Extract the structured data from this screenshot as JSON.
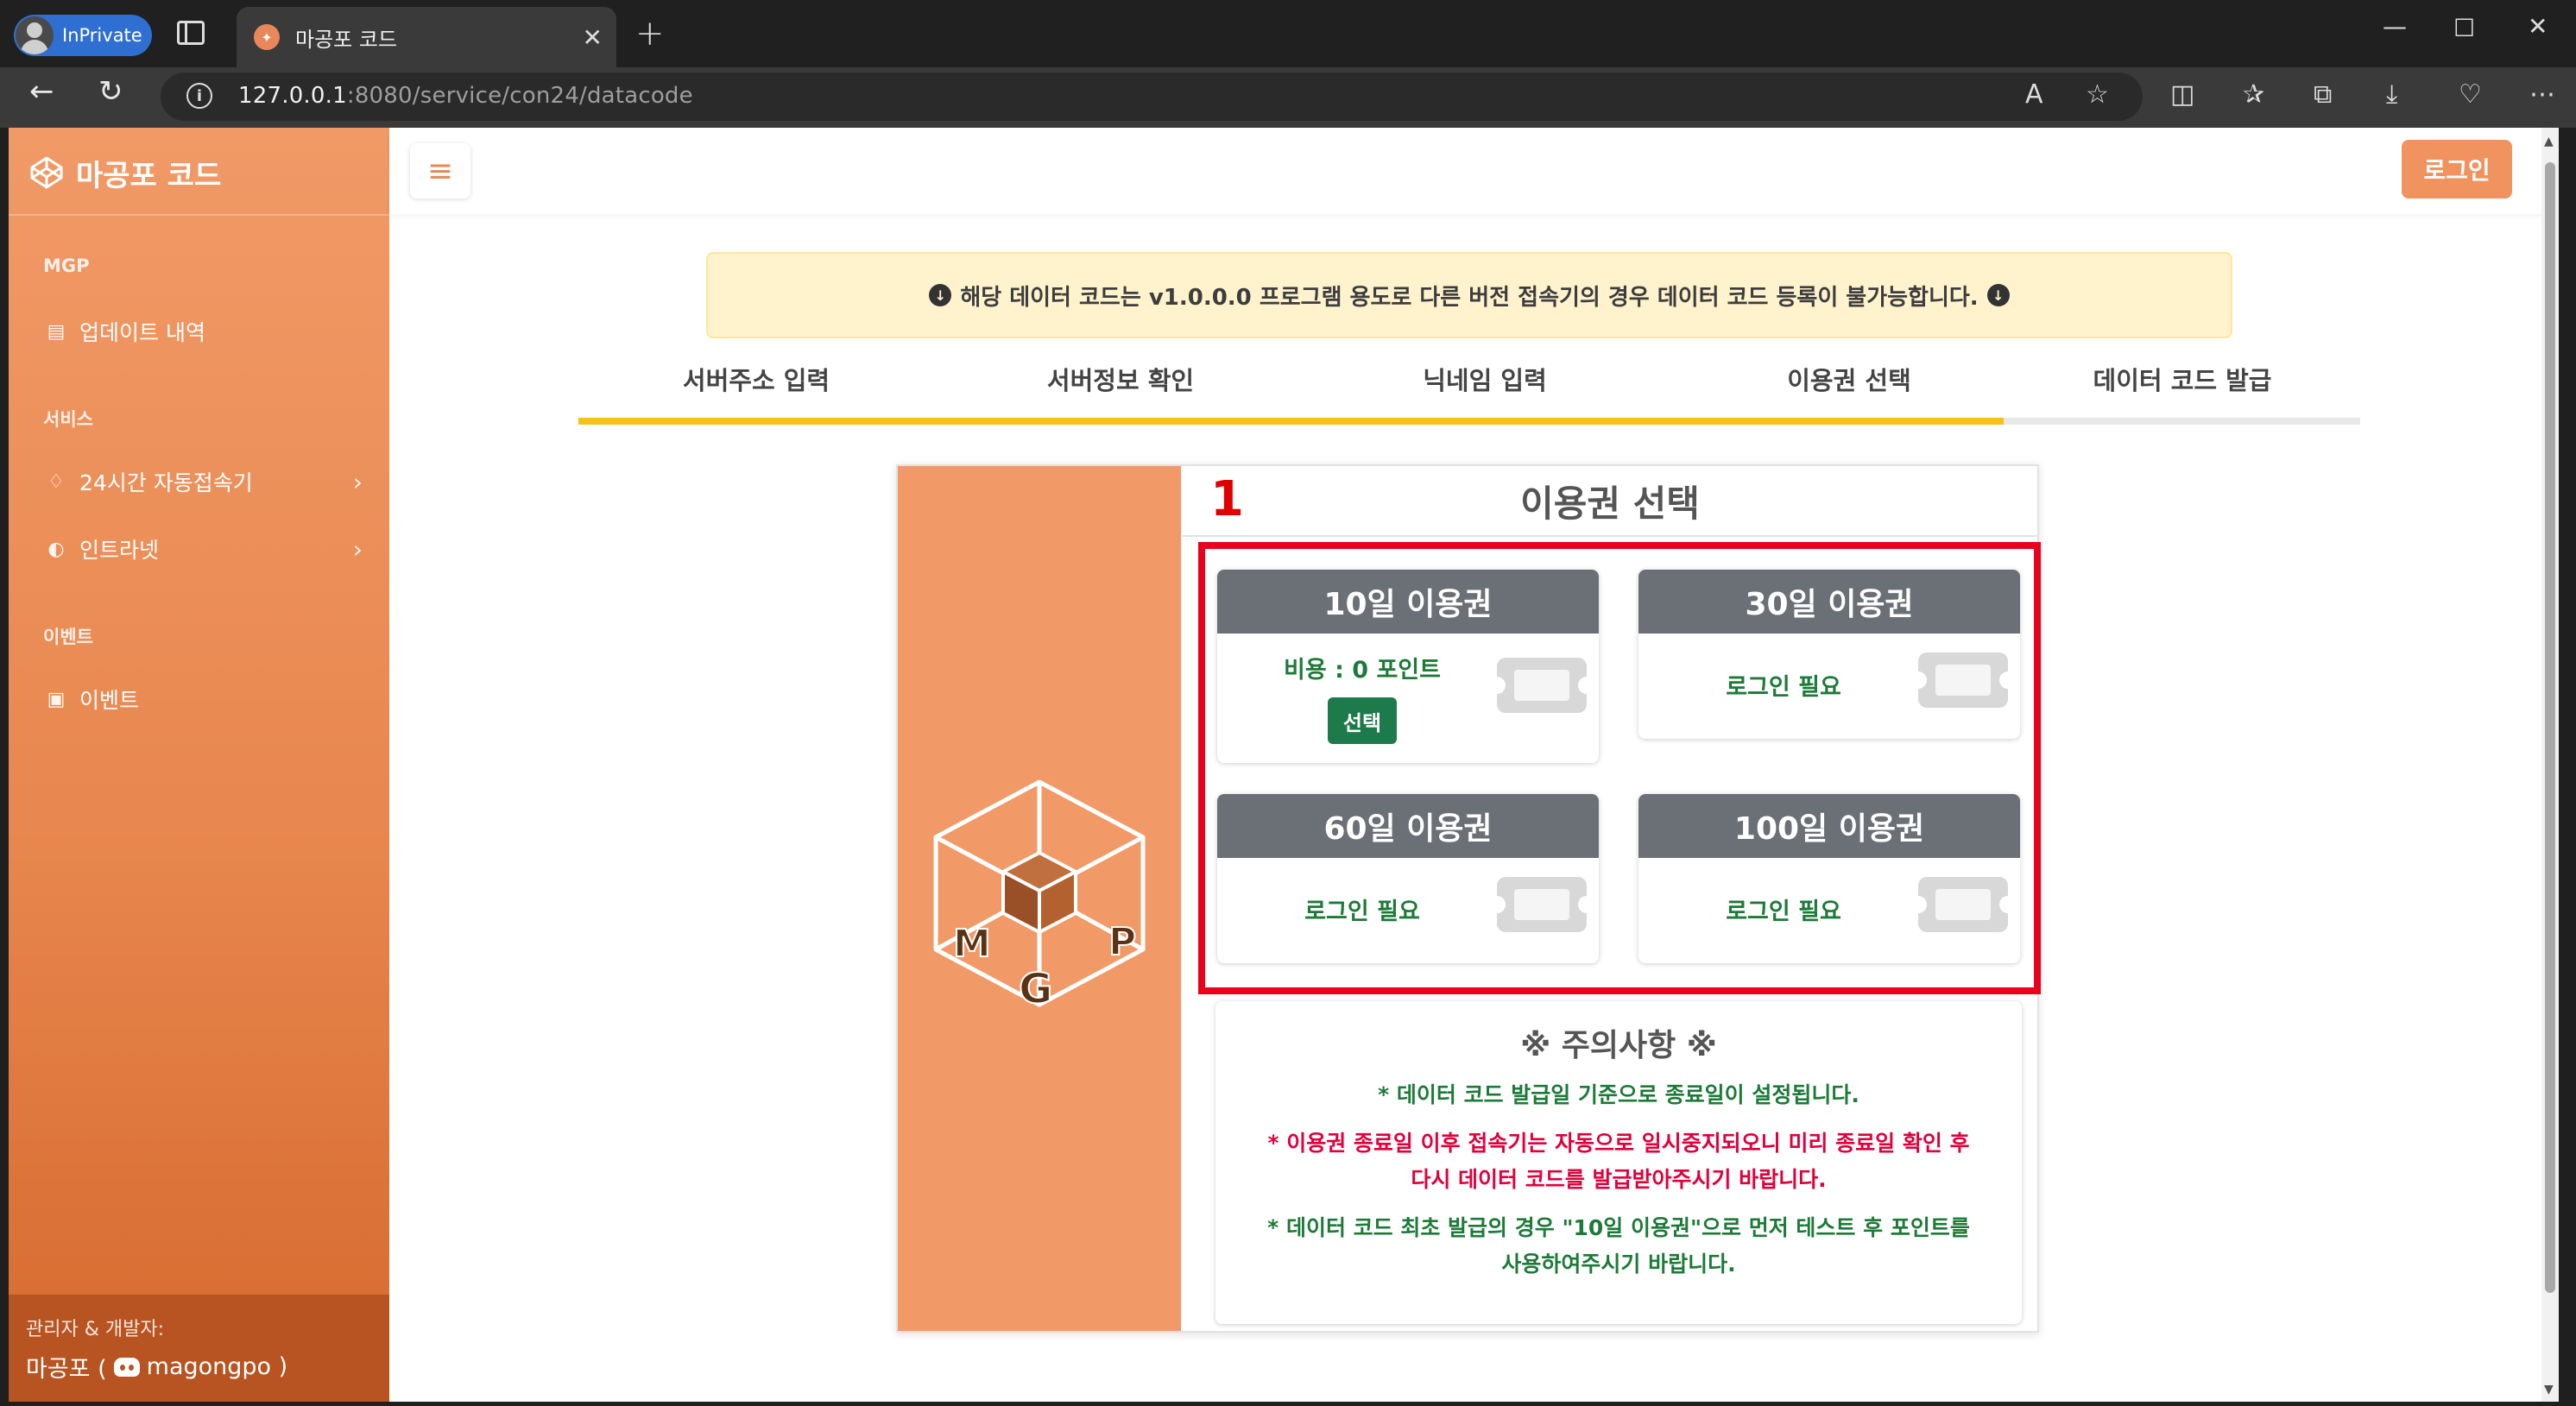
{
  "browser": {
    "inprivate_label": "InPrivate",
    "tab_title": "마공포 코드",
    "url_host": "127.0.0.1",
    "url_rest": ":8080/service/con24/datacode"
  },
  "sidebar": {
    "brand": "마공포 코드",
    "sections": [
      {
        "label": "MGP",
        "items": [
          {
            "label": "업데이트 내역",
            "icon": "clipboard-icon"
          }
        ]
      },
      {
        "label": "서비스",
        "items": [
          {
            "label": "24시간 자동접속기",
            "icon": "lightbulb-icon"
          },
          {
            "label": "인트라넷",
            "icon": "half-circle-icon"
          }
        ]
      },
      {
        "label": "이벤트",
        "items": [
          {
            "label": "이벤트",
            "icon": "calendar-icon"
          }
        ]
      }
    ],
    "footer_label": "관리자 & 개발자:",
    "footer_name": "마공포 (",
    "footer_discord": "magongpo )"
  },
  "topbar": {
    "menu_icon": "hamburger-icon",
    "login_label": "로그인"
  },
  "notice": {
    "text": "해당 데이터 코드는 v1.0.0.0 프로그램 용도로 다른 버전 접속기의 경우 데이터 코드 등록이 불가능합니다."
  },
  "steps": {
    "labels": [
      "서버주소 입력",
      "서버정보 확인",
      "닉네임 입력",
      "이용권 선택",
      "데이터 코드 발급"
    ],
    "completed_fraction": 0.8
  },
  "card": {
    "title": "이용권 선택",
    "annotation_number": "1",
    "tickets": [
      {
        "title": "10일 이용권",
        "cost": "비용 : 0 포인트",
        "button": "선택"
      },
      {
        "title": "30일 이용권",
        "status": "로그인 필요"
      },
      {
        "title": "60일 이용권",
        "status": "로그인 필요"
      },
      {
        "title": "100일 이용권",
        "status": "로그인 필요"
      }
    ],
    "caution": {
      "title": "※ 주의사항 ※",
      "line1": "* 데이터 코드 발급일 기준으로 종료일이 설정됩니다.",
      "line2a": "* 이용권 종료일 이후 접속기는 자동으로 일시중지되오니 미리 종료일 확인 후",
      "line2b": "다시 데이터 코드를 발급받아주시기 바랍니다.",
      "line3a": "* 데이터 코드 최초 발급의 경우 \"10일 이용권\"으로 먼저 테스트 후 포인트를",
      "line3b": "사용하여주시기 바랍니다."
    },
    "logo_letters": [
      "M",
      "G",
      "P"
    ]
  },
  "colors": {
    "sidebar": "#f19a67",
    "step_fill": "#f7c11b",
    "green": "#1d7a38",
    "red": "#e0003c",
    "annotation": "#e8001c"
  }
}
